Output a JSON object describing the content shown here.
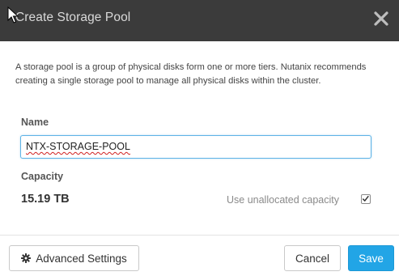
{
  "dialog": {
    "title": "Create Storage Pool",
    "description": "A storage pool is a group of physical disks form one or more tiers. Nutanix recommends creating a single storage pool to manage all physical disks within the cluster.",
    "name_label": "Name",
    "name_value": "NTX-STORAGE-POOL",
    "capacity_label": "Capacity",
    "capacity_value": "15.19 TB",
    "unallocated_label": "Use unallocated capacity",
    "unallocated_checked": true
  },
  "footer": {
    "advanced_label": "Advanced Settings",
    "cancel_label": "Cancel",
    "save_label": "Save"
  },
  "icons": {
    "close": "close-icon",
    "gear": "gear-icon",
    "cursor": "mouse-cursor-icon",
    "check": "checkmark-icon"
  },
  "colors": {
    "header_bg": "#3b3b3b",
    "primary": "#22a5e6",
    "input_focus": "#5fb3e6"
  }
}
